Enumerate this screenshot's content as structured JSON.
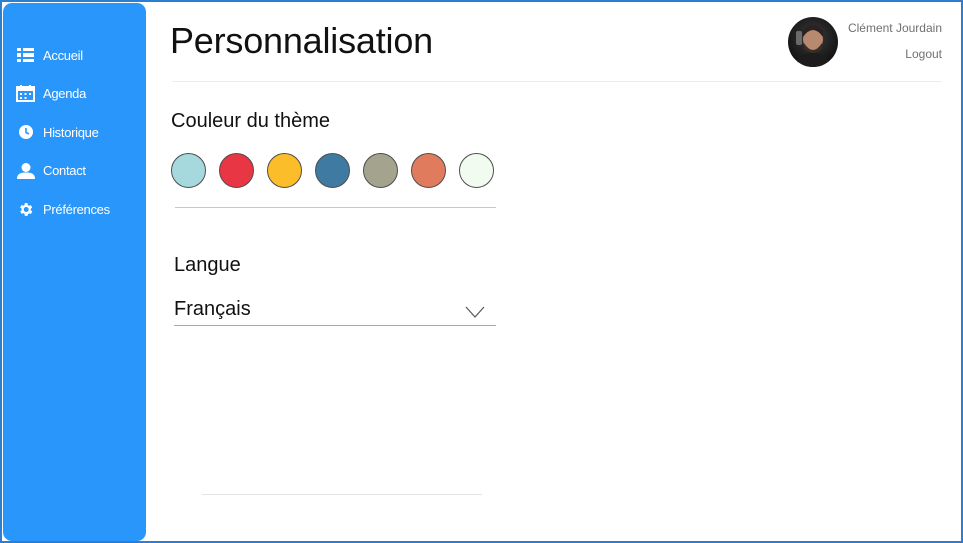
{
  "sidebar": {
    "items": [
      {
        "label": "Accueil",
        "icon": "dashboard-icon"
      },
      {
        "label": "Agenda",
        "icon": "calendar-icon"
      },
      {
        "label": "Historique",
        "icon": "clock-icon"
      },
      {
        "label": "Contact",
        "icon": "person-icon"
      },
      {
        "label": "Préférences",
        "icon": "gear-icon"
      }
    ],
    "color": "#2996fb"
  },
  "header": {
    "title": "Personnalisation",
    "user_name": "Clément Jourdain",
    "logout_label": "Logout"
  },
  "theme": {
    "label": "Couleur du thème",
    "swatches": [
      "#a5d9dd",
      "#e83645",
      "#fbbd29",
      "#3f7aa2",
      "#a3a38e",
      "#e17b5d",
      "#f1fbf0"
    ]
  },
  "language": {
    "label": "Langue",
    "selected": "Français"
  }
}
